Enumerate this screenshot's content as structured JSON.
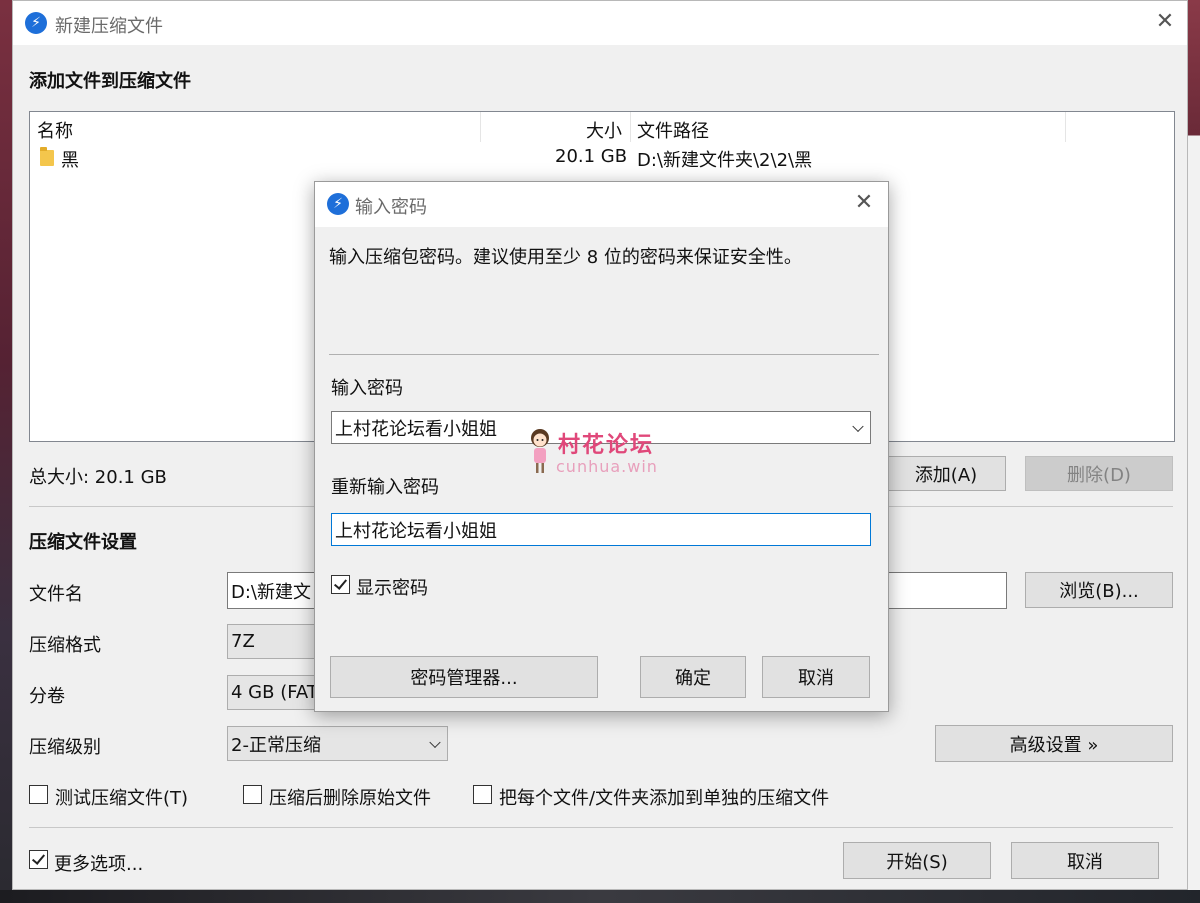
{
  "main": {
    "title": "新建压缩文件",
    "add_section_title": "添加文件到压缩文件",
    "columns": [
      "名称",
      "大小",
      "文件路径"
    ],
    "rows": [
      {
        "name": "黑",
        "size": "20.1 GB",
        "path": "D:\\新建文件夹\\2\\2\\黑"
      }
    ],
    "total_size": "总大小: 20.1 GB",
    "add_button": "添加(A)",
    "delete_button": "删除(D)",
    "settings_title": "压缩文件设置",
    "filename_label": "文件名",
    "filename_value": "D:\\新建文",
    "browse_button": "浏览(B)...",
    "format_label": "压缩格式",
    "format_value": "7Z",
    "volume_label": "分卷",
    "volume_value": "4 GB (FAT",
    "level_label": "压缩级别",
    "level_value": "2-正常压缩",
    "advanced_button": "高级设置 »",
    "test_checkbox": "测试压缩文件(T)",
    "delete_after_checkbox": "压缩后删除原始文件",
    "separate_checkbox": "把每个文件/文件夹添加到单独的压缩文件",
    "more_options_checkbox": "更多选项...",
    "start_button": "开始(S)",
    "cancel_button": "取消"
  },
  "dialog": {
    "title": "输入密码",
    "description": "输入压缩包密码。建议使用至少 8 位的密码来保证安全性。",
    "password_label": "输入密码",
    "password_value": "上村花论坛看小姐姐",
    "reenter_label": "重新输入密码",
    "reenter_value": "上村花论坛看小姐姐",
    "show_password": "显示密码",
    "password_manager_button": "密码管理器...",
    "ok_button": "确定",
    "cancel_button": "取消"
  },
  "watermark": {
    "title": "村花论坛",
    "subtitle": "cunhua.win"
  },
  "colors": {
    "accent": "#1e6fd9",
    "focus": "#0078d7",
    "watermark": "#e0487a"
  }
}
